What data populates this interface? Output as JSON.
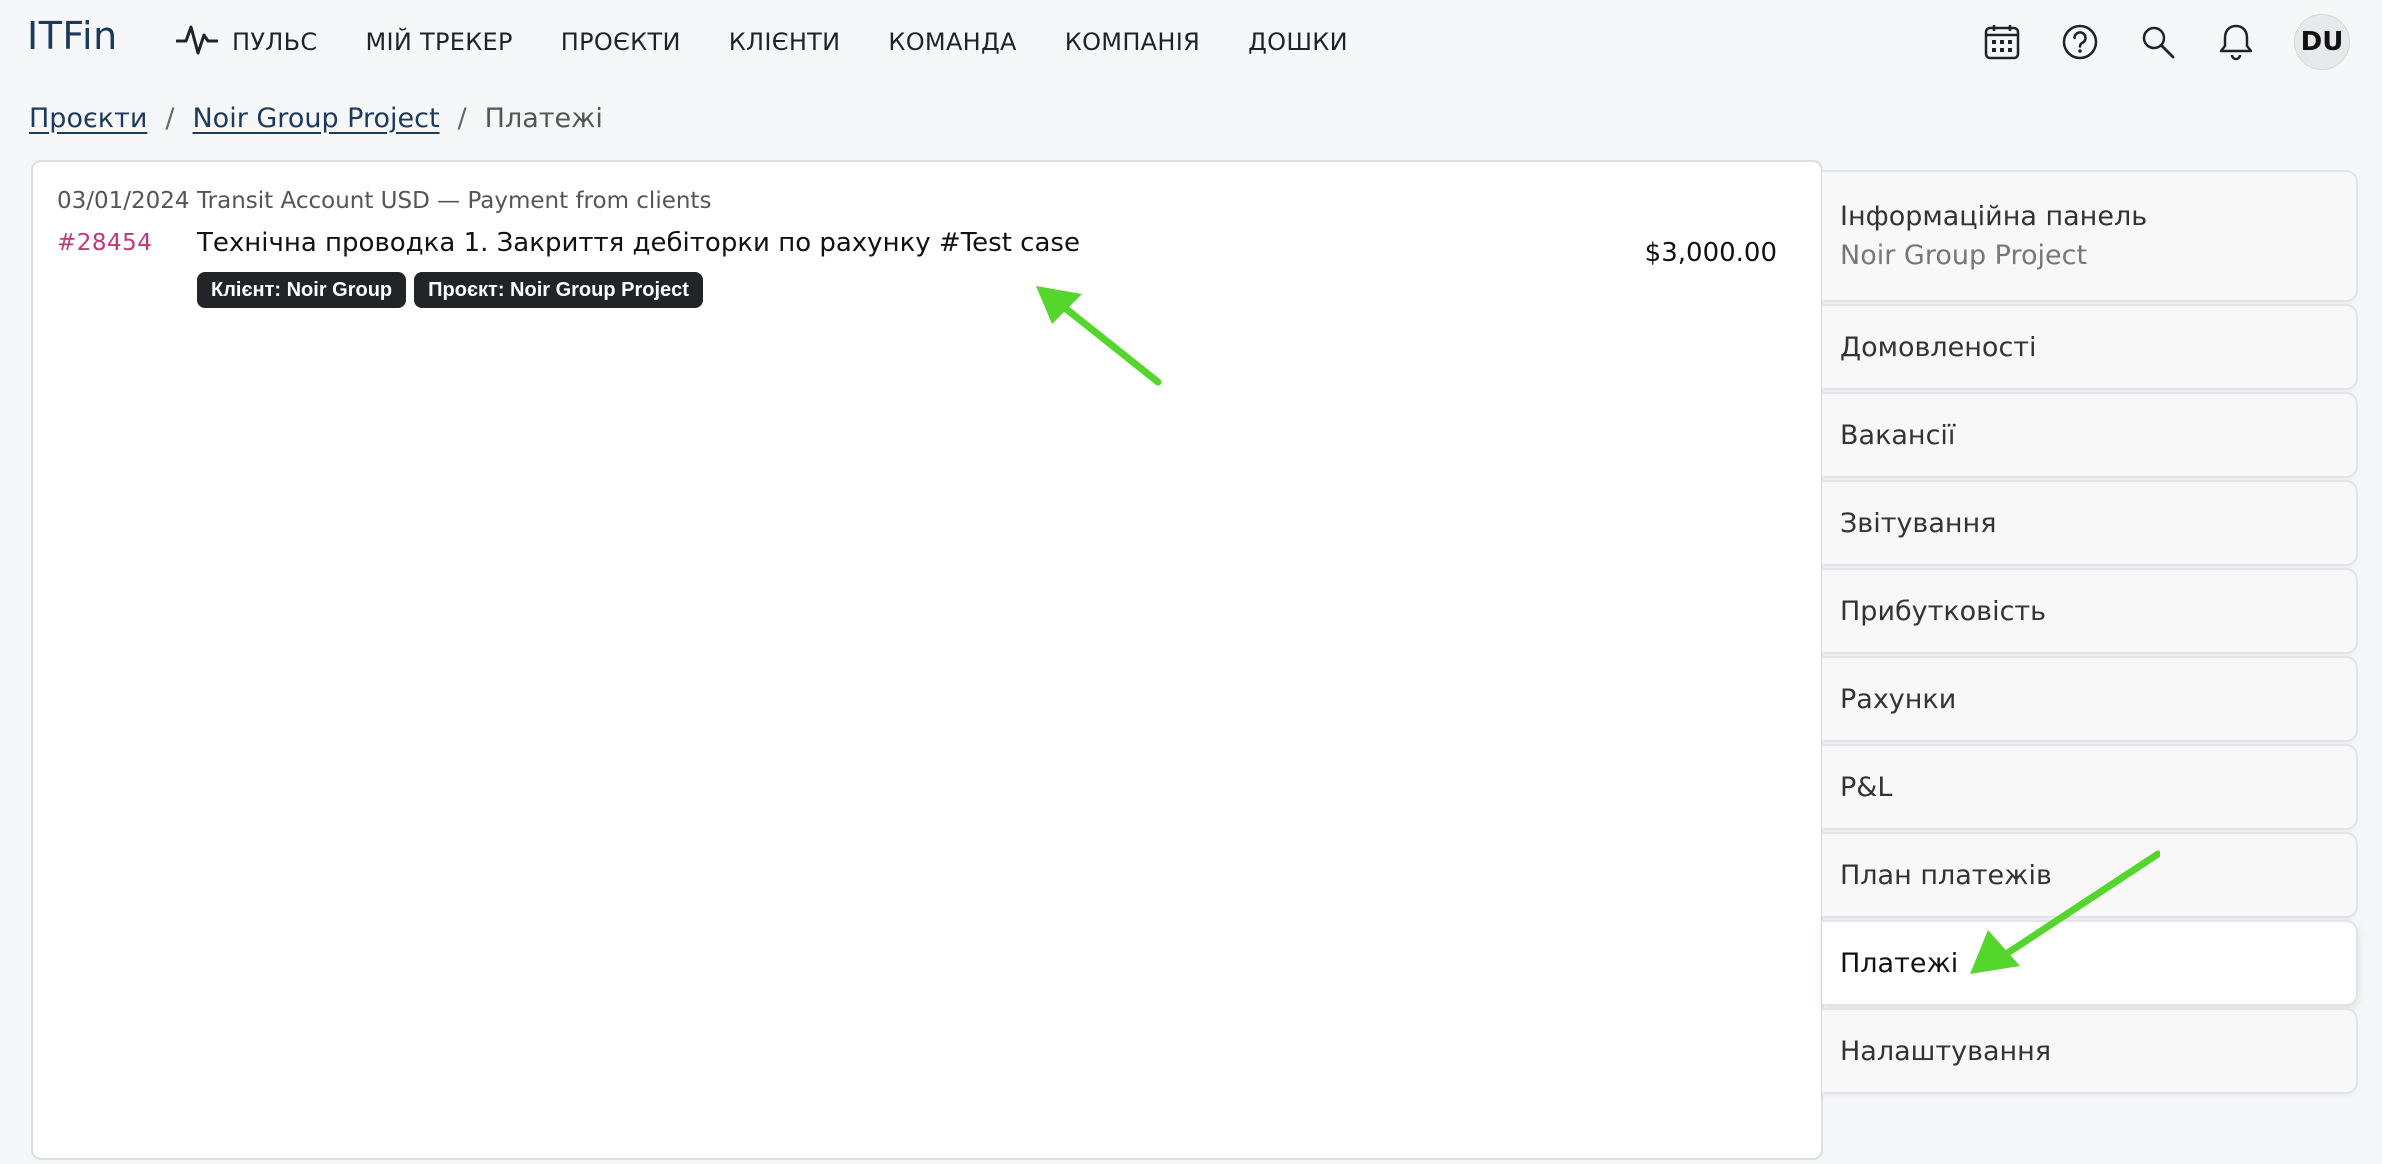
{
  "app": {
    "logo": "ITFin"
  },
  "nav": {
    "items": [
      {
        "label": "ПУЛЬС",
        "icon": "pulse-icon"
      },
      {
        "label": "МІЙ ТРЕКЕР"
      },
      {
        "label": "ПРОЄКТИ"
      },
      {
        "label": "КЛІЄНТИ"
      },
      {
        "label": "КОМАНДА"
      },
      {
        "label": "КОМПАНІЯ"
      },
      {
        "label": "ДОШКИ"
      }
    ]
  },
  "header_icons": [
    "calendar-icon",
    "help-icon",
    "search-icon",
    "bell-icon"
  ],
  "user": {
    "initials": "DU"
  },
  "breadcrumb": {
    "items": [
      "Проєкти",
      "Noir Group Project"
    ],
    "separator": "/",
    "current": "Платежі"
  },
  "payment": {
    "date": "03/01/2024",
    "account": "Transit Account USD — Payment from clients",
    "id": "#28454",
    "title": "Технічна проводка 1. Закриття дебіторки по рахунку #Test case",
    "amount": "$3,000.00",
    "tags": [
      "Клієнт: Noir Group",
      "Проєкт: Noir Group Project"
    ]
  },
  "side_menu": {
    "dashboard": {
      "label": "Інформаційна панель",
      "sub": "Noir Group Project"
    },
    "items": [
      "Домовленості",
      "Вакансії",
      "Звітування",
      "Прибутковість",
      "Рахунки",
      "P&L",
      "План платежів",
      "Платежі",
      "Налаштування"
    ],
    "active": "Платежі"
  },
  "colors": {
    "accent_link": "#1d3a5c",
    "id_pink": "#c2367a",
    "tag_bg": "#222428",
    "annotation_arrow": "#55d62c"
  }
}
